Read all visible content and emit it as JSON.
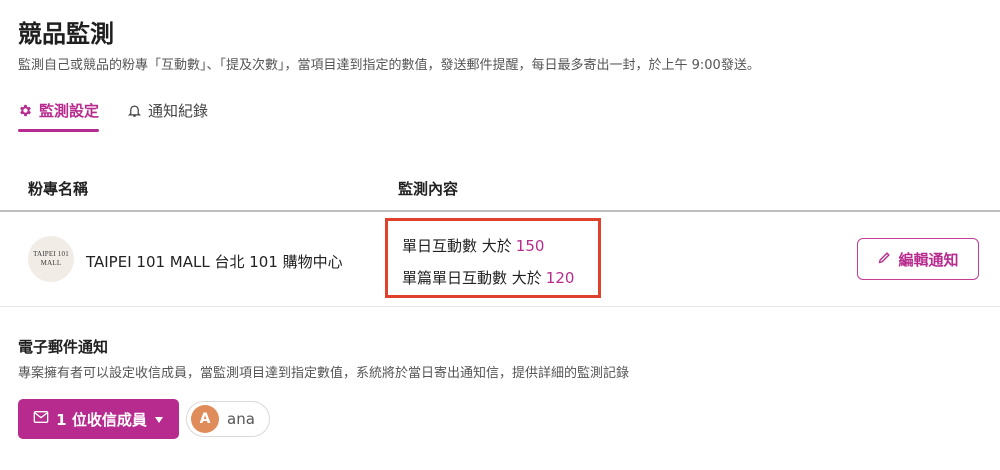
{
  "header": {
    "title": "競品監測",
    "description": "監測自己或競品的粉專「互動數」、「提及次數」，當項目達到指定的數值，發送郵件提醒，每日最多寄出一封，於上午 9:00發送。"
  },
  "tabs": [
    {
      "label": "監測設定",
      "icon": "gear-icon",
      "active": true
    },
    {
      "label": "通知紀錄",
      "icon": "bell-icon",
      "active": false
    }
  ],
  "table": {
    "columns": [
      "粉專名稱",
      "監測內容"
    ],
    "rows": [
      {
        "avatar_text": [
          "TAIPEI 101",
          "MALL"
        ],
        "page_name": "TAIPEI 101 MALL 台北 101 購物中心",
        "rules": [
          {
            "label": "單日互動數 大於",
            "value": "150"
          },
          {
            "label": "單篇單日互動數 大於",
            "value": "120"
          }
        ],
        "edit_label": "編輯通知"
      }
    ]
  },
  "email": {
    "title": "電子郵件通知",
    "description": "專案擁有者可以設定收信成員，當監測項目達到指定數值，系統將於當日寄出通知信，提供詳細的監測記錄",
    "recipients_label": "1 位收信成員",
    "recipients": [
      {
        "initial": "A",
        "name": "ana"
      }
    ]
  },
  "colors": {
    "accent": "#b82b8e",
    "highlight_border": "#e0412c",
    "chip_avatar": "#e08b5a"
  }
}
